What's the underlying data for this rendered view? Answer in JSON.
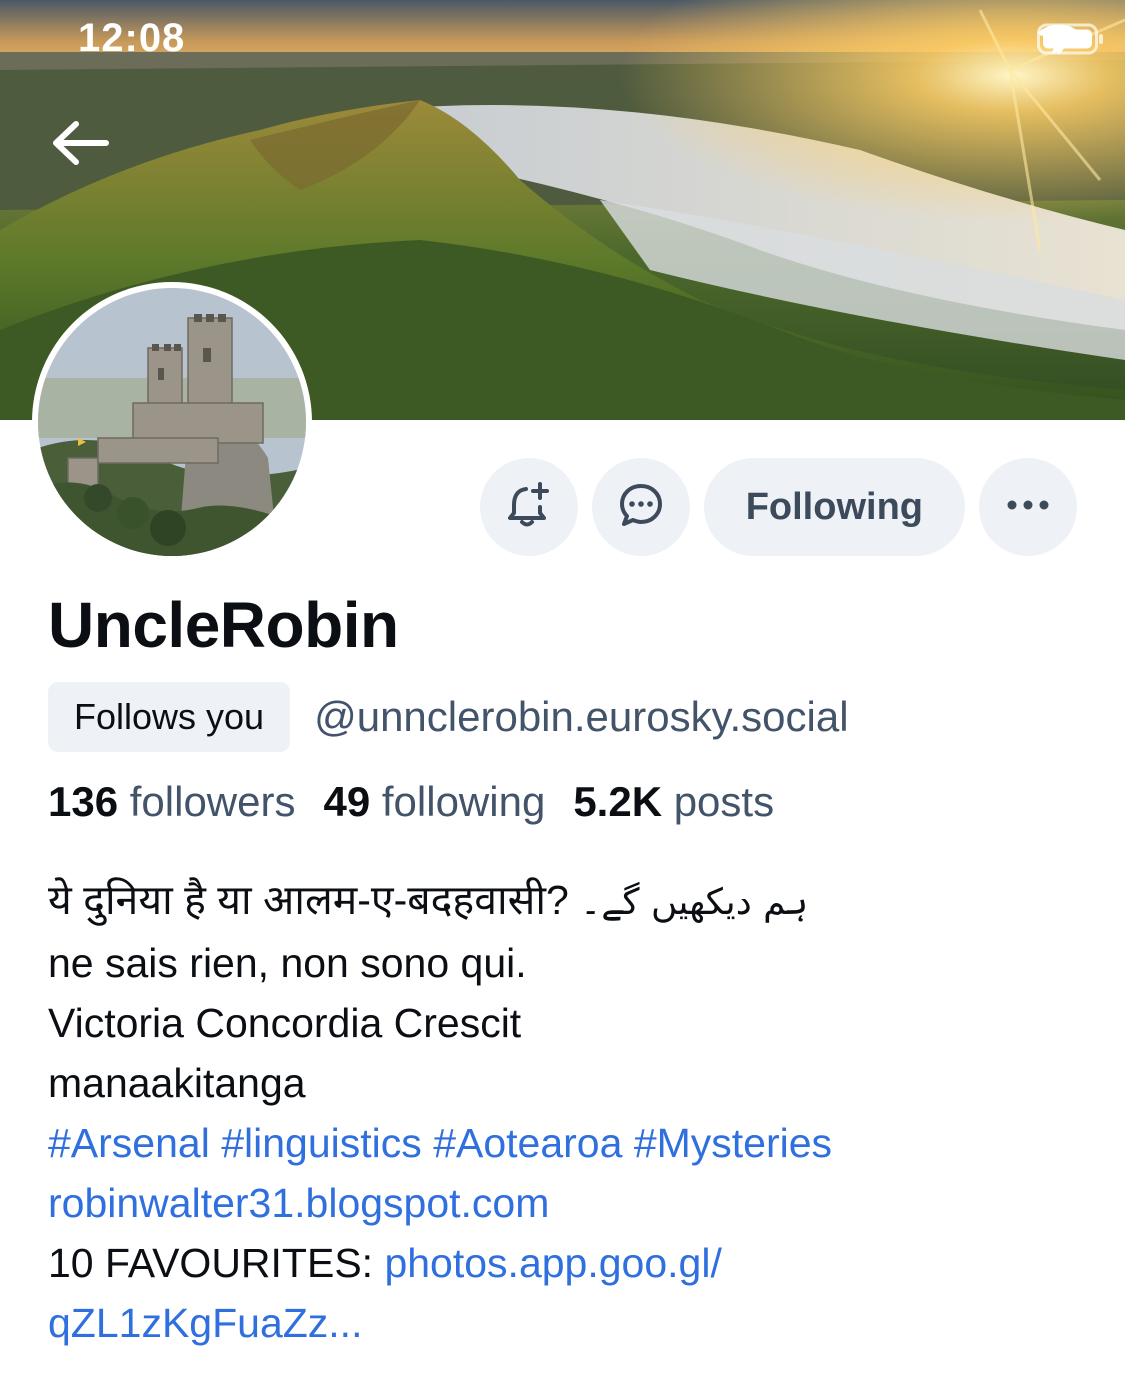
{
  "status_bar": {
    "time": "12:08",
    "icons": [
      "airplane-icon",
      "wifi-icon",
      "battery-icon"
    ]
  },
  "header": {
    "back_icon": "back-arrow-icon"
  },
  "actions": {
    "subscribe_icon": "bell-plus-icon",
    "message_icon": "chat-bubble-icon",
    "following_label": "Following",
    "more_icon": "ellipsis-icon"
  },
  "profile": {
    "display_name": "UncleRobin",
    "follows_you_label": "Follows you",
    "handle": "@unnclerobin.eurosky.social",
    "stats": {
      "followers_count": "136",
      "followers_label": "followers",
      "following_count": "49",
      "following_label": "following",
      "posts_count": "5.2K",
      "posts_label": "posts"
    },
    "bio": {
      "line1_hindi": "ये दुनिया है या आलम-ए-बदहवासी?",
      "line1_urdu": "ہم دیکھیں گے۔",
      "line2": "ne sais rien, non sono qui.",
      "line3": "Victoria Concordia Crescit",
      "line4": "manaakitanga",
      "hashtags": [
        "#Arsenal",
        "#linguistics",
        "#Aotearoa",
        "#Mysteries"
      ],
      "blog_link": "robinwalter31.blogspot.com",
      "favourites_prefix": "10 FAVOURITES: ",
      "favourites_link_1": "photos.app.goo.gl/",
      "favourites_link_2": "qZL1zKgFuaZz..."
    }
  },
  "colors": {
    "link": "#2f6fde",
    "muted": "#42536a",
    "button_bg": "#eef1f5"
  }
}
